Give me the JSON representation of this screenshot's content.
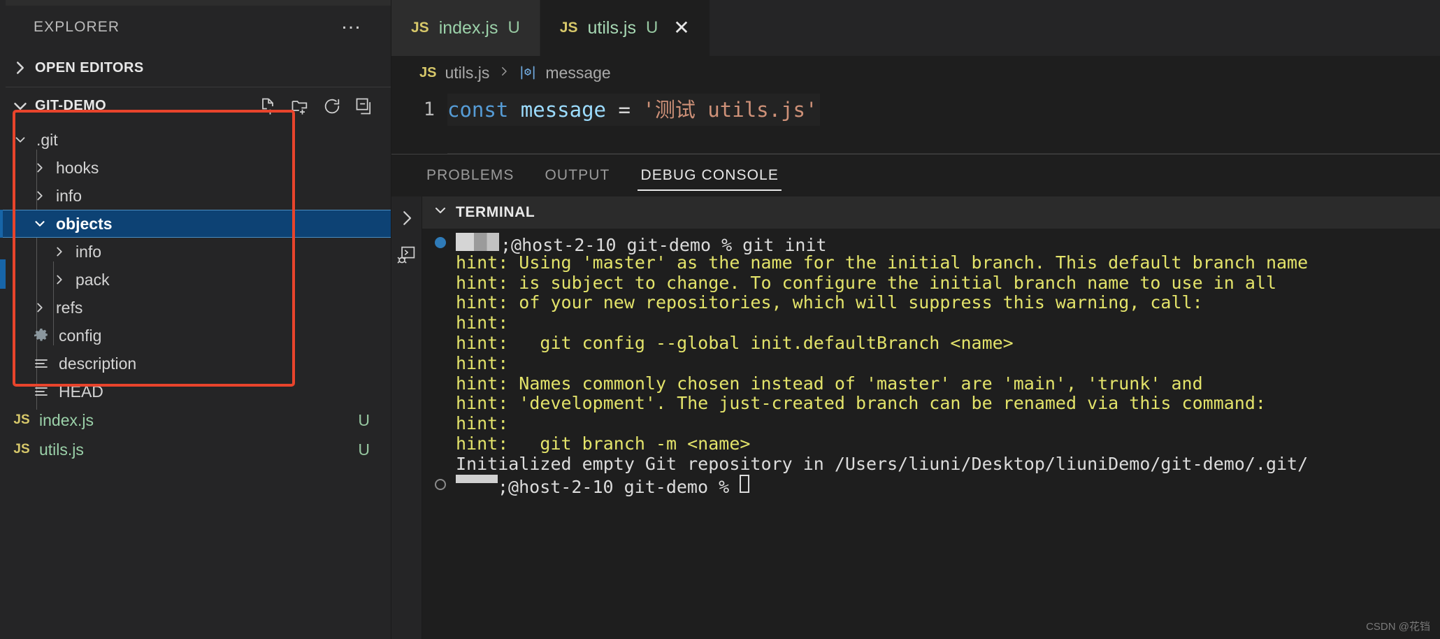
{
  "sidebar": {
    "title": "EXPLORER",
    "overflow_label": "…",
    "sections": [
      {
        "label": "OPEN EDITORS",
        "expanded": false
      },
      {
        "label": "GIT-DEMO",
        "expanded": true
      }
    ],
    "section_actions": [
      "new-file-icon",
      "new-folder-icon",
      "refresh-icon",
      "collapse-all-icon"
    ],
    "tree": [
      {
        "name": ".git",
        "kind": "folder",
        "depth": 1,
        "expanded": true,
        "selected": false
      },
      {
        "name": "hooks",
        "kind": "folder",
        "depth": 2,
        "expanded": false,
        "selected": false
      },
      {
        "name": "info",
        "kind": "folder",
        "depth": 2,
        "expanded": false,
        "selected": false
      },
      {
        "name": "objects",
        "kind": "folder",
        "depth": 2,
        "expanded": true,
        "selected": true
      },
      {
        "name": "info",
        "kind": "folder",
        "depth": 3,
        "expanded": false,
        "selected": false
      },
      {
        "name": "pack",
        "kind": "folder",
        "depth": 3,
        "expanded": false,
        "selected": false
      },
      {
        "name": "refs",
        "kind": "folder",
        "depth": 2,
        "expanded": false,
        "selected": false
      },
      {
        "name": "config",
        "kind": "gear",
        "depth": 2,
        "expanded": null,
        "selected": false
      },
      {
        "name": "description",
        "kind": "doc",
        "depth": 2,
        "expanded": null,
        "selected": false
      },
      {
        "name": "HEAD",
        "kind": "doc",
        "depth": 2,
        "expanded": null,
        "selected": false
      },
      {
        "name": "index.js",
        "kind": "js",
        "depth": 1,
        "expanded": null,
        "selected": false,
        "status": "U"
      },
      {
        "name": "utils.js",
        "kind": "js",
        "depth": 1,
        "expanded": null,
        "selected": false,
        "status": "U"
      }
    ]
  },
  "editor": {
    "tabs": [
      {
        "icon": "js-icon",
        "label": "index.js",
        "status": "U",
        "active": false,
        "closable": false
      },
      {
        "icon": "js-icon",
        "label": "utils.js",
        "status": "U",
        "active": true,
        "closable": true,
        "close_label": "✕"
      }
    ],
    "breadcrumb": {
      "file_icon": "js-icon",
      "file": "utils.js",
      "separator": "❯",
      "symbol_icon": "variable-cube-icon",
      "symbol": "message"
    },
    "line_number": "1",
    "code": {
      "keyword": "const",
      "space1": " ",
      "variable": "message",
      "operator": " = ",
      "string": "'测试 utils.js'"
    }
  },
  "panel": {
    "tabs": [
      {
        "label": "PROBLEMS",
        "active": false
      },
      {
        "label": "OUTPUT",
        "active": false
      },
      {
        "label": "DEBUG CONSOLE",
        "active": true
      }
    ],
    "side_icons": [
      "chevron-right-icon",
      "debug-terminal-icon"
    ],
    "terminal_section": {
      "label": "TERMINAL",
      "expanded": true
    },
    "terminal_lines": [
      {
        "type": "prompt",
        "bullet": "filled",
        "mosaic": "username-redacted",
        "text": ";@host-2-10 git-demo % git init"
      },
      {
        "type": "hint",
        "text": "hint: Using 'master' as the name for the initial branch. This default branch name"
      },
      {
        "type": "hint",
        "text": "hint: is subject to change. To configure the initial branch name to use in all"
      },
      {
        "type": "hint",
        "text": "hint: of your new repositories, which will suppress this warning, call:"
      },
      {
        "type": "hint",
        "text": "hint:"
      },
      {
        "type": "hint",
        "text": "hint:   git config --global init.defaultBranch <name>"
      },
      {
        "type": "hint",
        "text": "hint:"
      },
      {
        "type": "hint",
        "text": "hint: Names commonly chosen instead of 'master' are 'main', 'trunk' and"
      },
      {
        "type": "hint",
        "text": "hint: 'development'. The just-created branch can be renamed via this command:"
      },
      {
        "type": "hint",
        "text": "hint:"
      },
      {
        "type": "hint",
        "text": "hint:   git branch -m <name>"
      },
      {
        "type": "plain",
        "text": "Initialized empty Git repository in /Users/liuni/Desktop/liuniDemo/git-demo/.git/"
      },
      {
        "type": "prompt",
        "bullet": "hollow",
        "mosaic": "username-redacted",
        "text": ";@host-2-10 git-demo % ",
        "cursor": true
      }
    ]
  },
  "watermark": "CSDN @花铛",
  "colors": {
    "selection_bg": "#0d4274",
    "selection_border": "#4a8ec2",
    "annotation_red": "#e8442c",
    "hint_yellow": "#e3e36a",
    "js_green": "#9bd1a9",
    "js_yellow": "#d7c86a",
    "keyword_blue": "#569cd6",
    "variable_blue": "#9cdcfe",
    "string_orange": "#ce9178"
  }
}
